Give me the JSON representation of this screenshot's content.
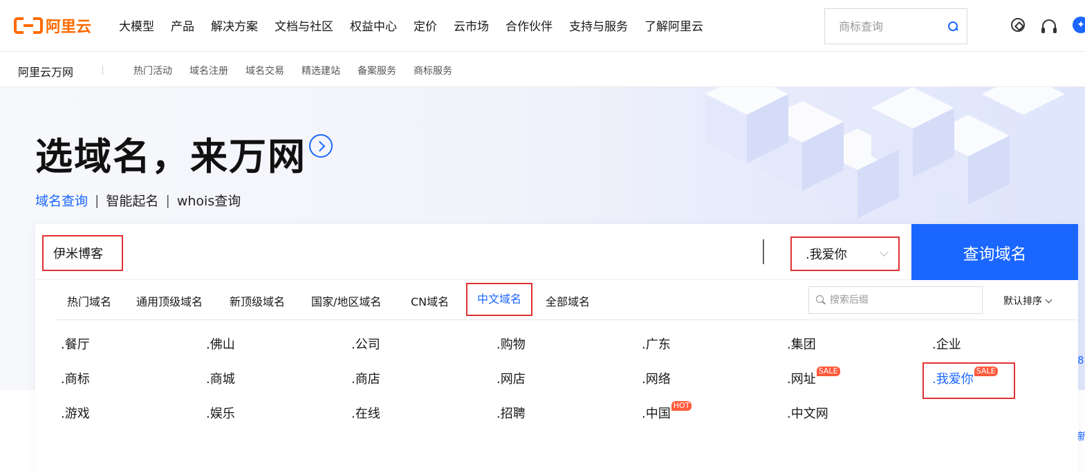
{
  "logo": {
    "text": "阿里云"
  },
  "nav": {
    "items": [
      "大模型",
      "产品",
      "解决方案",
      "文档与社区",
      "权益中心",
      "定价",
      "云市场",
      "合作伙伴",
      "支持与服务",
      "了解阿里云"
    ]
  },
  "top_search": {
    "placeholder": "商标查询"
  },
  "top_icons": {
    "ai_glyph": "✦"
  },
  "subnav": {
    "brand": "阿里云万网",
    "links": [
      "热门活动",
      "域名注册",
      "域名交易",
      "精选建站",
      "备案服务",
      "商标服务"
    ]
  },
  "hero": {
    "title": "选域名，来万网",
    "links": {
      "active": "域名查询",
      "sep": "|",
      "item2": "智能起名",
      "item3": "whois查询"
    }
  },
  "search": {
    "value": "伊米博客",
    "suffix_selected": ".我爱你",
    "button": "查询域名"
  },
  "tabs": [
    "热门域名",
    "通用顶级域名",
    "新顶级域名",
    "国家/地区域名",
    "CN域名",
    "中文域名",
    "全部域名"
  ],
  "filter": {
    "placeholder": "搜索后缀",
    "sort_label": "默认排序"
  },
  "suffixes": [
    [
      {
        "t": ".餐厅"
      },
      {
        "t": ".佛山"
      },
      {
        "t": ".公司"
      },
      {
        "t": ".购物"
      },
      {
        "t": ".广东"
      },
      {
        "t": ".集团"
      },
      {
        "t": ".企业"
      }
    ],
    [
      {
        "t": ".商标"
      },
      {
        "t": ".商城"
      },
      {
        "t": ".商店"
      },
      {
        "t": ".网店"
      },
      {
        "t": ".网络"
      },
      {
        "t": ".网址",
        "badge": "SALE"
      },
      {
        "t": ".我爱你",
        "badge": "SALE"
      }
    ],
    [
      {
        "t": ".游戏"
      },
      {
        "t": ".娱乐"
      },
      {
        "t": ".在线"
      },
      {
        "t": ".招聘"
      },
      {
        "t": ".中国",
        "badge": "HOT"
      },
      {
        "t": ".中文网"
      }
    ]
  ],
  "edge": {
    "a": "8",
    "b": "新"
  }
}
